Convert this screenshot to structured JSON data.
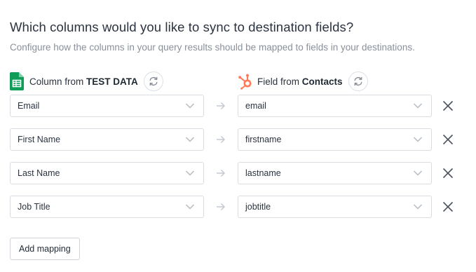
{
  "header": {
    "title": "Which columns would you like to sync to destination fields?",
    "subtitle": "Configure how the columns in your query results should be mapped to fields in your destinations."
  },
  "source_column": {
    "label_prefix": "Column from",
    "source_name": "TEST DATA",
    "icon": "google-sheets-icon",
    "refresh_icon": "refresh-icon"
  },
  "destination_column": {
    "label_prefix": "Field from",
    "object_name": "Contacts",
    "icon": "hubspot-icon",
    "refresh_icon": "refresh-icon"
  },
  "mappings": [
    {
      "source": "Email",
      "destination": "email"
    },
    {
      "source": "First Name",
      "destination": "firstname"
    },
    {
      "source": "Last Name",
      "destination": "lastname"
    },
    {
      "source": "Job Title",
      "destination": "jobtitle"
    }
  ],
  "add_mapping_label": "Add mapping",
  "colors": {
    "sheets_green": "#0F9D58",
    "hubspot_orange": "#FF7A59",
    "border": "#D9DCE1",
    "muted_text": "#8A909A"
  }
}
